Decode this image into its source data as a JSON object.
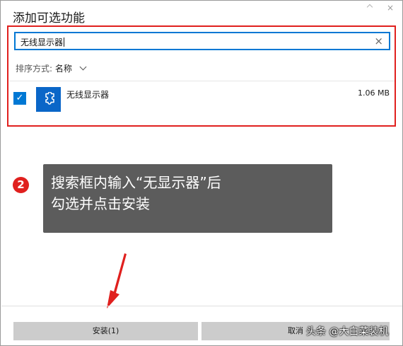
{
  "dialog": {
    "title": "添加可选功能",
    "close_glyph": "×"
  },
  "search": {
    "value": "无线显示器",
    "clear_glyph": "×"
  },
  "sort": {
    "label": "排序方式:",
    "value": "名称"
  },
  "feature": {
    "checked": true,
    "check_glyph": "✓",
    "name": "无线显示器",
    "size": "1.06 MB",
    "icon": "puzzle-piece-icon"
  },
  "annotation": {
    "step_number": "2",
    "line1": "搜索框内输入“无显示器”后",
    "line2": "勾选并点击安装"
  },
  "buttons": {
    "install_label": "安装(1)",
    "cancel_label": "取消"
  },
  "watermark": "头条 @大白菜装机",
  "colors": {
    "accent": "#0078d4",
    "highlight": "#e0201e",
    "tip_bg": "#5c5c5c",
    "button_bg": "#cccccc"
  }
}
